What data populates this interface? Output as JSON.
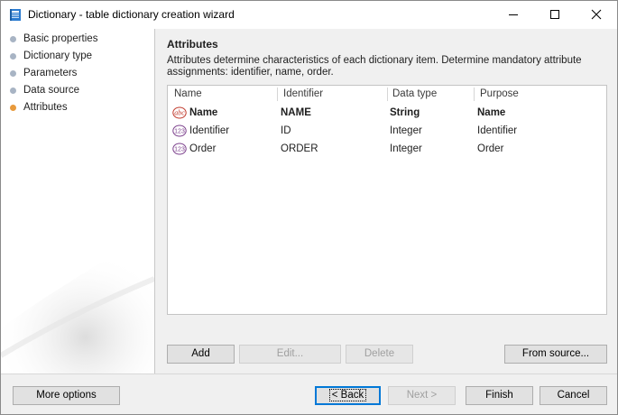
{
  "window": {
    "title": "Dictionary - table dictionary creation wizard"
  },
  "sidebar": {
    "steps": [
      {
        "label": "Basic properties",
        "active": false
      },
      {
        "label": "Dictionary type",
        "active": false
      },
      {
        "label": "Parameters",
        "active": false
      },
      {
        "label": "Data source",
        "active": false
      },
      {
        "label": "Attributes",
        "active": true
      }
    ]
  },
  "main": {
    "title": "Attributes",
    "description": "Attributes determine characteristics of each dictionary item. Determine mandatory attribute assignments: identifier, name, order.",
    "columns": [
      "Name",
      "Identifier",
      "Data type",
      "Purpose"
    ],
    "rows": [
      {
        "icon": "string-type-icon",
        "name": "Name",
        "identifier": "NAME",
        "data_type": "String",
        "purpose": "Name",
        "bold": true
      },
      {
        "icon": "integer-type-icon",
        "name": "Identifier",
        "identifier": "ID",
        "data_type": "Integer",
        "purpose": "Identifier",
        "bold": false
      },
      {
        "icon": "integer-type-icon",
        "name": "Order",
        "identifier": "ORDER",
        "data_type": "Integer",
        "purpose": "Order",
        "bold": false
      }
    ],
    "grid_buttons": {
      "add": "Add",
      "edit": "Edit...",
      "delete": "Delete",
      "from_source": "From source..."
    }
  },
  "footer": {
    "more_options": "More options",
    "back": "< Back",
    "next": "Next >",
    "finish": "Finish",
    "cancel": "Cancel"
  },
  "icons": {
    "string_type_glyph": "abc",
    "integer_type_glyph": "123"
  },
  "colors": {
    "active_step": "#e89a3c",
    "inactive_step": "#a8b4c4",
    "string_icon": "#c0392b",
    "integer_icon": "#7b3f8c",
    "focus_border": "#0078d7"
  }
}
